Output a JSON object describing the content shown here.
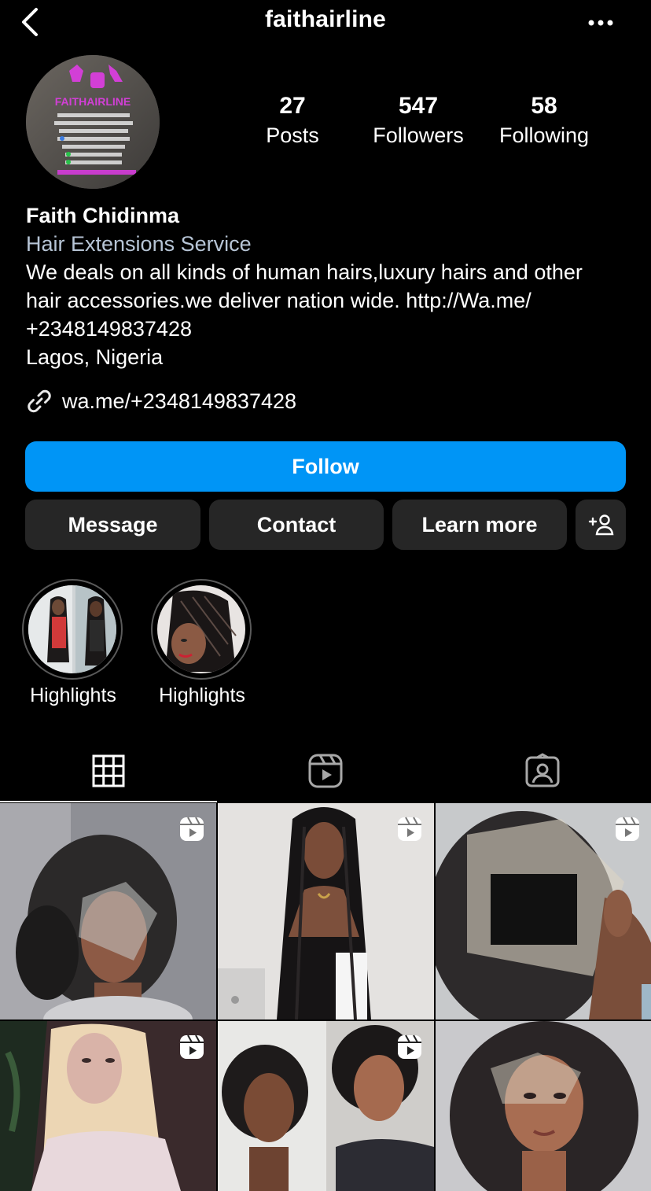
{
  "header": {
    "username": "faithairline"
  },
  "profile": {
    "avatar_text": "FAITHAIRLINE",
    "stats": [
      {
        "value": "27",
        "label": "Posts"
      },
      {
        "value": "547",
        "label": "Followers"
      },
      {
        "value": "58",
        "label": "Following"
      }
    ],
    "name": "Faith Chidinma",
    "category": "Hair Extensions Service",
    "description": "We deals on all kinds of human hairs,luxury hairs and other\nhair accessories.we deliver nation wide. http://Wa.me/\n+2348149837428",
    "location": "Lagos, Nigeria",
    "link": "wa.me/+2348149837428"
  },
  "actions": {
    "follow": "Follow",
    "message": "Message",
    "contact": "Contact",
    "learn_more": "Learn more",
    "add_person_icon": "add-person-icon"
  },
  "highlights": [
    {
      "label": "Highlights"
    },
    {
      "label": "Highlights"
    }
  ],
  "tabs": [
    {
      "icon": "grid-icon",
      "active": true
    },
    {
      "icon": "reels-icon",
      "active": false
    },
    {
      "icon": "tagged-icon",
      "active": false
    }
  ],
  "colors": {
    "background": "#000000",
    "accent": "#0095f6",
    "button": "#262626",
    "category_text": "#b7c5d6"
  }
}
